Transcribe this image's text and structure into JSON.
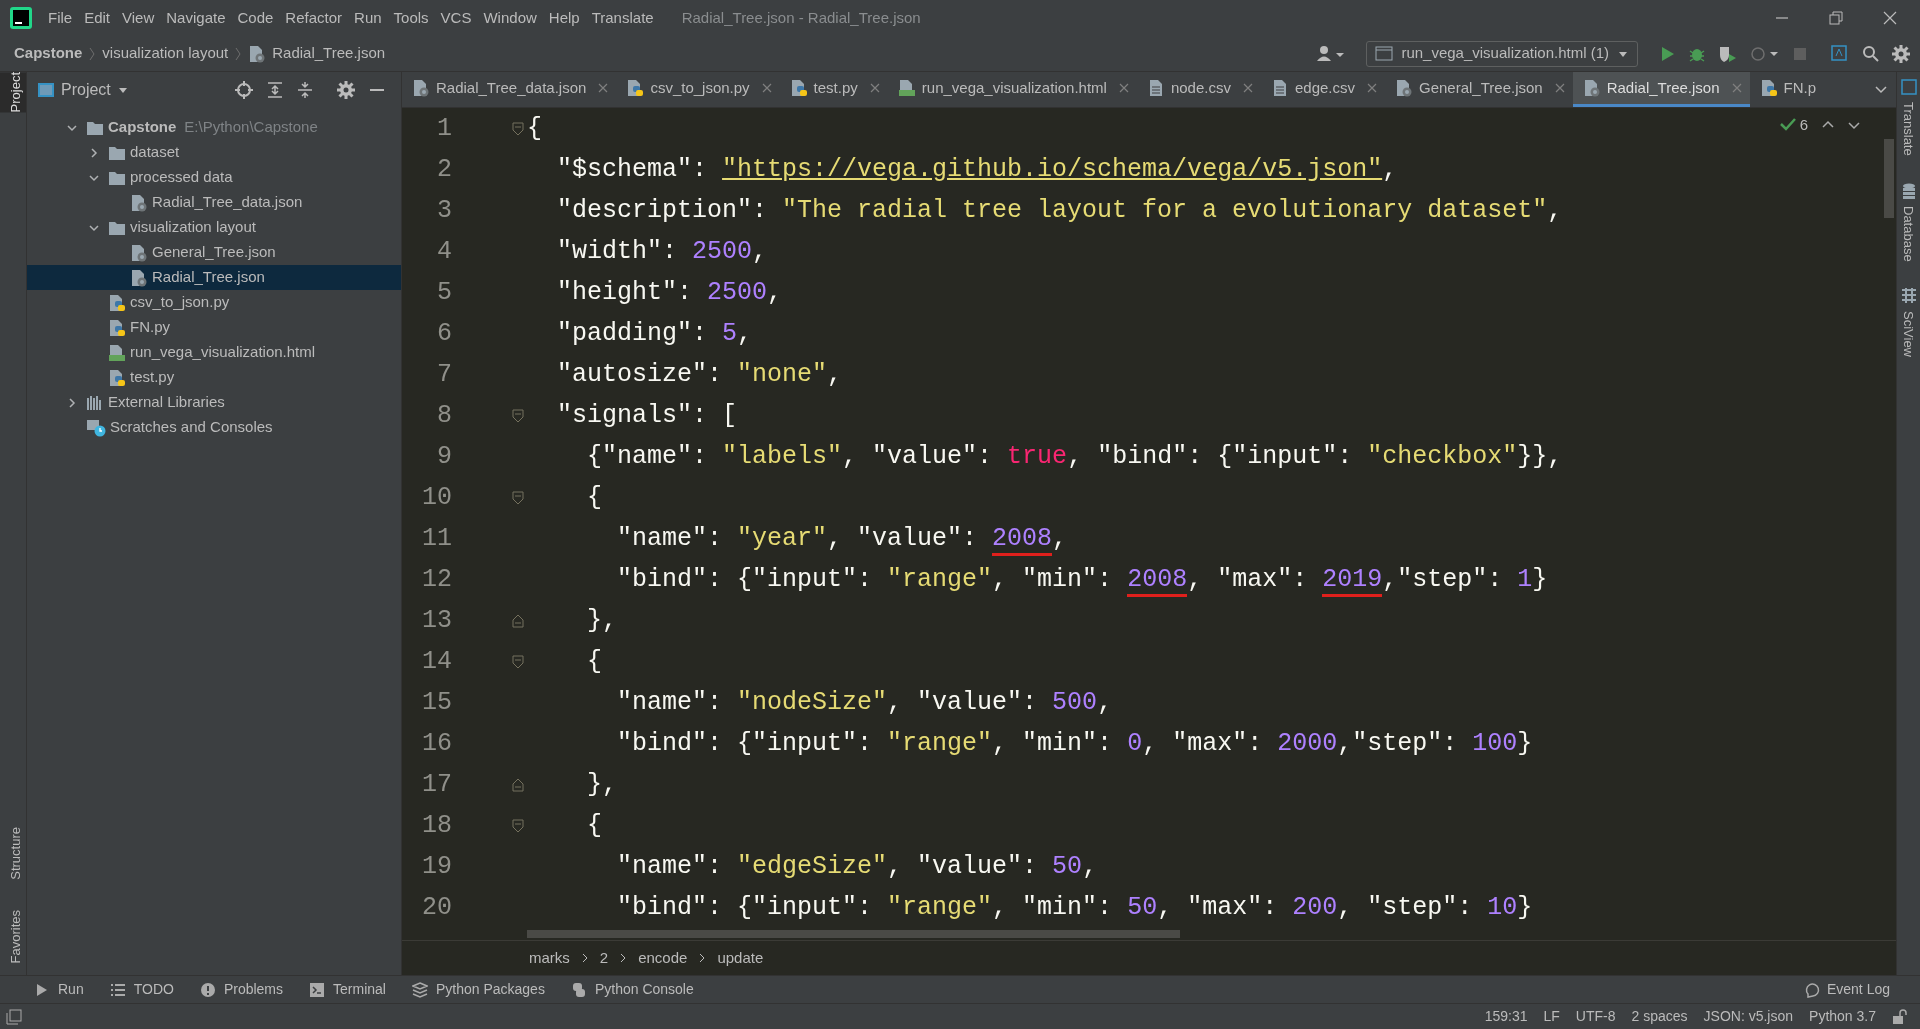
{
  "menu_bar": {
    "menus": [
      "File",
      "Edit",
      "View",
      "Navigate",
      "Code",
      "Refactor",
      "Run",
      "Tools",
      "VCS",
      "Window",
      "Help",
      "Translate"
    ],
    "title": "Radial_Tree.json - Radial_Tree.json"
  },
  "nav_bar": {
    "breadcrumb": [
      "Capstone",
      "visualization layout",
      "Radial_Tree.json"
    ],
    "run_config": "run_vega_visualization.html (1)"
  },
  "left_stripe": [
    {
      "label": "Project",
      "selected": true
    },
    {
      "label": "Structure",
      "selected": false
    },
    {
      "label": "Favorites",
      "selected": false
    }
  ],
  "project_panel": {
    "title": "Project",
    "tree": [
      {
        "label": "Capstone",
        "detail": "E:\\Python\\Capstone",
        "kind": "folder",
        "expanded": true,
        "selected": false,
        "children": [
          {
            "label": "dataset",
            "kind": "folder",
            "expanded": false,
            "selected": false
          },
          {
            "label": "processed data",
            "kind": "folder",
            "expanded": true,
            "selected": false,
            "children": [
              {
                "label": "Radial_Tree_data.json",
                "kind": "json",
                "selected": false
              }
            ]
          },
          {
            "label": "visualization layout",
            "kind": "folder",
            "expanded": true,
            "selected": false,
            "children": [
              {
                "label": "General_Tree.json",
                "kind": "json",
                "selected": false
              },
              {
                "label": "Radial_Tree.json",
                "kind": "json",
                "selected": true
              }
            ]
          },
          {
            "label": "csv_to_json.py",
            "kind": "python",
            "selected": false
          },
          {
            "label": "FN.py",
            "kind": "python",
            "selected": false
          },
          {
            "label": "run_vega_visualization.html",
            "kind": "html",
            "selected": false
          },
          {
            "label": "test.py",
            "kind": "python",
            "selected": false
          }
        ]
      },
      {
        "label": "External Libraries",
        "kind": "libraries",
        "expanded": false,
        "selected": false
      },
      {
        "label": "Scratches and Consoles",
        "kind": "scratches",
        "selected": false
      }
    ]
  },
  "editor": {
    "tabs": [
      {
        "label": "Radial_Tree_data.json",
        "kind": "json",
        "selected": false
      },
      {
        "label": "csv_to_json.py",
        "kind": "python",
        "selected": false
      },
      {
        "label": "test.py",
        "kind": "python",
        "selected": false
      },
      {
        "label": "run_vega_visualization.html",
        "kind": "html",
        "selected": false
      },
      {
        "label": "node.csv",
        "kind": "csv",
        "selected": false
      },
      {
        "label": "edge.csv",
        "kind": "csv",
        "selected": false
      },
      {
        "label": "General_Tree.json",
        "kind": "json",
        "selected": false
      },
      {
        "label": "Radial_Tree.json",
        "kind": "json",
        "selected": true
      },
      {
        "label": "FN.p",
        "kind": "python",
        "selected": false
      }
    ],
    "inspections": "6",
    "lines": [
      {
        "number": "1",
        "kind": "fold_start",
        "tokens": [
          {
            "kind": "plain",
            "text": "{"
          }
        ]
      },
      {
        "number": "2",
        "kind": "plain",
        "tokens": [
          {
            "kind": "plain",
            "text": "  \"$schema\": "
          },
          {
            "kind": "link",
            "text": "\"https://vega.github.io/schema/vega/v5.json\""
          },
          {
            "kind": "plain",
            "text": ","
          }
        ]
      },
      {
        "number": "3",
        "kind": "plain",
        "tokens": [
          {
            "kind": "plain",
            "text": "  \"description\": "
          },
          {
            "kind": "string",
            "text": "\"The radial tree layout for a evolutionary dataset\""
          },
          {
            "kind": "plain",
            "text": ","
          }
        ]
      },
      {
        "number": "4",
        "kind": "plain",
        "tokens": [
          {
            "kind": "plain",
            "text": "  \"width\": "
          },
          {
            "kind": "number",
            "text": "2500"
          },
          {
            "kind": "plain",
            "text": ","
          }
        ]
      },
      {
        "number": "5",
        "kind": "plain",
        "tokens": [
          {
            "kind": "plain",
            "text": "  \"height\": "
          },
          {
            "kind": "number",
            "text": "2500"
          },
          {
            "kind": "plain",
            "text": ","
          }
        ]
      },
      {
        "number": "6",
        "kind": "plain",
        "tokens": [
          {
            "kind": "plain",
            "text": "  \"padding\": "
          },
          {
            "kind": "number",
            "text": "5"
          },
          {
            "kind": "plain",
            "text": ","
          }
        ]
      },
      {
        "number": "7",
        "kind": "plain",
        "tokens": [
          {
            "kind": "plain",
            "text": "  \"autosize\": "
          },
          {
            "kind": "string",
            "text": "\"none\""
          },
          {
            "kind": "plain",
            "text": ","
          }
        ]
      },
      {
        "number": "8",
        "kind": "fold_start",
        "tokens": [
          {
            "kind": "plain",
            "text": "  \"signals\": ["
          }
        ]
      },
      {
        "number": "9",
        "kind": "plain",
        "tokens": [
          {
            "kind": "plain",
            "text": "    {\"name\": "
          },
          {
            "kind": "string",
            "text": "\"labels\""
          },
          {
            "kind": "plain",
            "text": ", \"value\": "
          },
          {
            "kind": "boolean",
            "text": "true"
          },
          {
            "kind": "plain",
            "text": ", \"bind\": {\"input\": "
          },
          {
            "kind": "string",
            "text": "\"checkbox\""
          },
          {
            "kind": "plain",
            "text": "}},"
          }
        ]
      },
      {
        "number": "10",
        "kind": "fold_start",
        "tokens": [
          {
            "kind": "plain",
            "text": "    {"
          }
        ]
      },
      {
        "number": "11",
        "kind": "plain",
        "tokens": [
          {
            "kind": "plain",
            "text": "      \"name\": "
          },
          {
            "kind": "string",
            "text": "\"year\""
          },
          {
            "kind": "plain",
            "text": ", \"value\": "
          },
          {
            "kind": "number",
            "text": "2008",
            "underlined": true
          },
          {
            "kind": "plain",
            "text": ","
          }
        ]
      },
      {
        "number": "12",
        "kind": "plain",
        "tokens": [
          {
            "kind": "plain",
            "text": "      \"bind\": {\"input\": "
          },
          {
            "kind": "string",
            "text": "\"range\""
          },
          {
            "kind": "plain",
            "text": ", \"min\": "
          },
          {
            "kind": "number",
            "text": "2008",
            "underlined": true
          },
          {
            "kind": "plain",
            "text": ", \"max\": "
          },
          {
            "kind": "number",
            "text": "2019",
            "underlined": true
          },
          {
            "kind": "plain",
            "text": ",\"step\": "
          },
          {
            "kind": "number",
            "text": "1"
          },
          {
            "kind": "plain",
            "text": "}"
          }
        ]
      },
      {
        "number": "13",
        "kind": "fold_end",
        "tokens": [
          {
            "kind": "plain",
            "text": "    },"
          }
        ]
      },
      {
        "number": "14",
        "kind": "fold_start",
        "tokens": [
          {
            "kind": "plain",
            "text": "    {"
          }
        ]
      },
      {
        "number": "15",
        "kind": "plain",
        "tokens": [
          {
            "kind": "plain",
            "text": "      \"name\": "
          },
          {
            "kind": "string",
            "text": "\"nodeSize\""
          },
          {
            "kind": "plain",
            "text": ", \"value\": "
          },
          {
            "kind": "number",
            "text": "500"
          },
          {
            "kind": "plain",
            "text": ","
          }
        ]
      },
      {
        "number": "16",
        "kind": "plain",
        "tokens": [
          {
            "kind": "plain",
            "text": "      \"bind\": {\"input\": "
          },
          {
            "kind": "string",
            "text": "\"range\""
          },
          {
            "kind": "plain",
            "text": ", \"min\": "
          },
          {
            "kind": "number",
            "text": "0"
          },
          {
            "kind": "plain",
            "text": ", \"max\": "
          },
          {
            "kind": "number",
            "text": "2000"
          },
          {
            "kind": "plain",
            "text": ",\"step\": "
          },
          {
            "kind": "number",
            "text": "100"
          },
          {
            "kind": "plain",
            "text": "}"
          }
        ]
      },
      {
        "number": "17",
        "kind": "fold_end",
        "tokens": [
          {
            "kind": "plain",
            "text": "    },"
          }
        ]
      },
      {
        "number": "18",
        "kind": "fold_start",
        "tokens": [
          {
            "kind": "plain",
            "text": "    {"
          }
        ]
      },
      {
        "number": "19",
        "kind": "plain",
        "tokens": [
          {
            "kind": "plain",
            "text": "      \"name\": "
          },
          {
            "kind": "string",
            "text": "\"edgeSize\""
          },
          {
            "kind": "plain",
            "text": ", \"value\": "
          },
          {
            "kind": "number",
            "text": "50"
          },
          {
            "kind": "plain",
            "text": ","
          }
        ]
      },
      {
        "number": "20",
        "kind": "plain",
        "tokens": [
          {
            "kind": "plain",
            "text": "      \"bind\": {\"input\": "
          },
          {
            "kind": "string",
            "text": "\"range\""
          },
          {
            "kind": "plain",
            "text": ", \"min\": "
          },
          {
            "kind": "number",
            "text": "50"
          },
          {
            "kind": "plain",
            "text": ", \"max\": "
          },
          {
            "kind": "number",
            "text": "200"
          },
          {
            "kind": "plain",
            "text": ", \"step\": "
          },
          {
            "kind": "number",
            "text": "10"
          },
          {
            "kind": "plain",
            "text": "}"
          }
        ]
      }
    ],
    "breadcrumb": [
      "marks",
      "2",
      "encode",
      "update"
    ]
  },
  "right_stripe": [
    {
      "label": "Translate",
      "kind": "translate"
    },
    {
      "label": "Database",
      "kind": "database"
    },
    {
      "label": "SciView",
      "kind": "sciview"
    }
  ],
  "tool_bar": {
    "items": [
      {
        "label": "Run",
        "kind": "run"
      },
      {
        "label": "TODO",
        "kind": "todo"
      },
      {
        "label": "Problems",
        "kind": "problems"
      },
      {
        "label": "Terminal",
        "kind": "terminal"
      },
      {
        "label": "Python Packages",
        "kind": "packages"
      },
      {
        "label": "Python Console",
        "kind": "console"
      }
    ],
    "event_log": "Event Log"
  },
  "status_bar": [
    "159:31",
    "LF",
    "UTF-8",
    "2 spaces",
    "JSON: v5.json",
    "Python 3.7"
  ]
}
